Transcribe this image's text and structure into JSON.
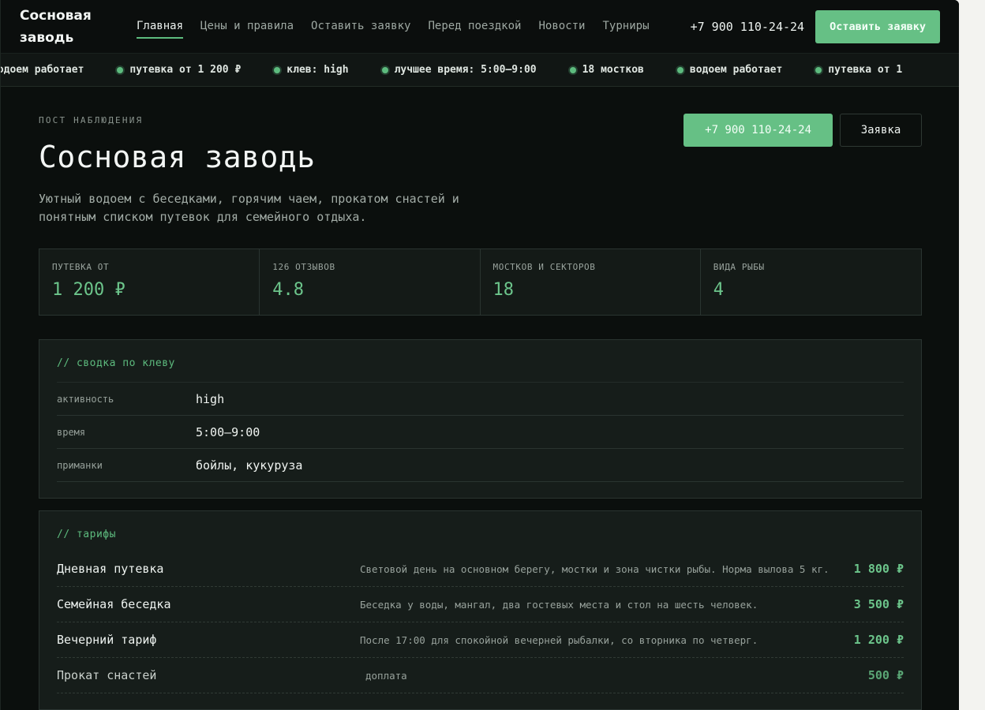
{
  "header": {
    "logo": "Сосновая\nзаводь",
    "nav": [
      {
        "label": "Главная",
        "active": true
      },
      {
        "label": "Цены и правила"
      },
      {
        "label": "Оставить заявку"
      },
      {
        "label": "Перед поездкой"
      },
      {
        "label": "Новости"
      },
      {
        "label": "Турниры"
      }
    ],
    "phone": "+7 900 110-24-24",
    "cta": "Оставить заявку"
  },
  "ticker": [
    "водоем работает",
    "путевка от 1 200 ₽",
    "клев: high",
    "лучшее время: 5:00–9:00",
    "18 мостков",
    "водоем работает",
    "путевка от 1"
  ],
  "hero": {
    "eyebrow": "ПОСТ НАБЛЮДЕНИЯ",
    "title": "Сосновая заводь",
    "lead": "Уютный водоем с беседками, горячим чаем, прокатом снастей и понятным списком путевок для семейного отдыха.",
    "phone_button": "+7 900 110-24-24",
    "request_button": "Заявка"
  },
  "stats": [
    {
      "label": "ПУТЕВКА ОТ",
      "value": "1 200 ₽"
    },
    {
      "label": "126 ОТЗЫВОВ",
      "value": "4.8"
    },
    {
      "label": "МОСТКОВ И СЕКТОРОВ",
      "value": "18"
    },
    {
      "label": "ВИДА РЫБЫ",
      "value": "4"
    }
  ],
  "bite": {
    "title": "// сводка по клеву",
    "rows": [
      {
        "key": "активность",
        "value": "high"
      },
      {
        "key": "время",
        "value": "5:00–9:00"
      },
      {
        "key": "приманки",
        "value": "бойлы, кукуруза"
      }
    ]
  },
  "tariffs": {
    "title": "// тарифы",
    "rows": [
      {
        "name": "Дневная путевка",
        "desc": "Световой день на основном берегу, мостки и зона чистки рыбы. Норма вылова 5 кг.",
        "price": "1 800 ₽"
      },
      {
        "name": "Семейная беседка",
        "desc": "Беседка у воды, мангал, два гостевых места и стол на шесть человек.",
        "price": "3 500 ₽"
      },
      {
        "name": "Вечерний тариф",
        "desc": "После 17:00 для спокойной вечерней рыбалки, со вторника по четверг.",
        "price": "1 200 ₽"
      },
      {
        "name": "Прокат снастей",
        "desc": "доплата",
        "price": "500 ₽"
      }
    ]
  }
}
